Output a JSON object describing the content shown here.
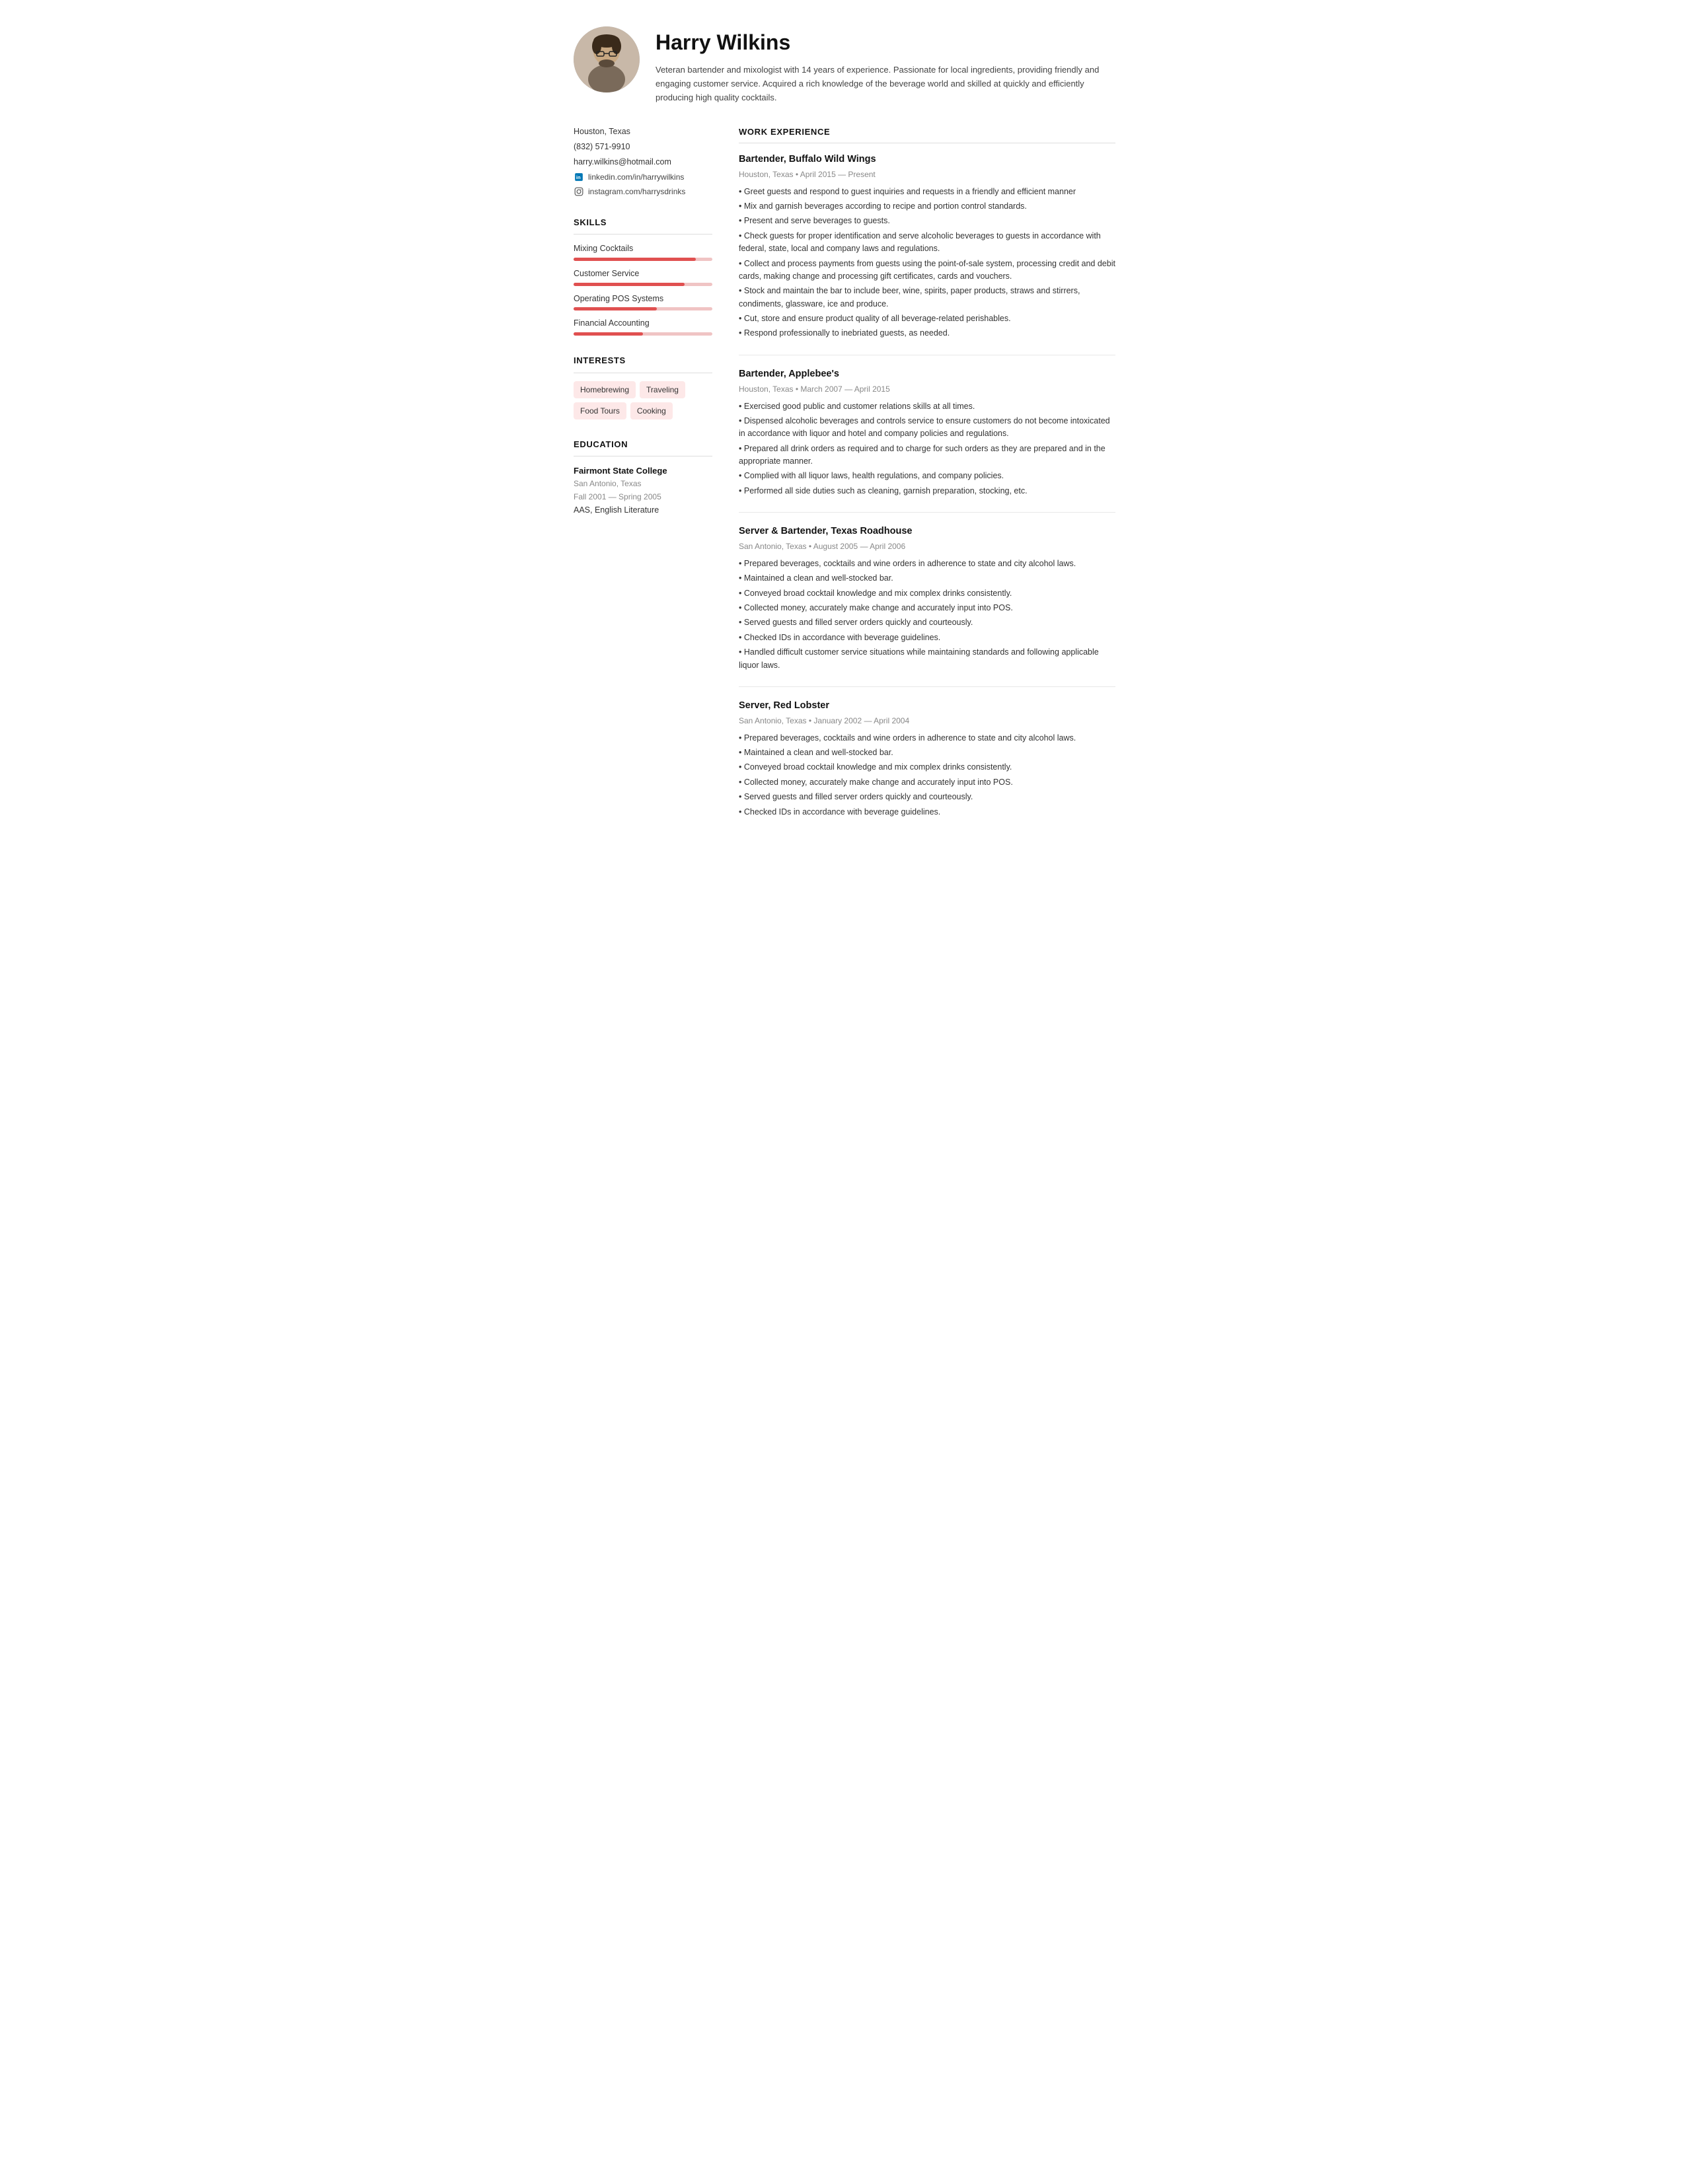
{
  "header": {
    "name": "Harry Wilkins",
    "summary": "Veteran bartender and mixologist with 14 years of experience. Passionate for local ingredients, providing friendly and engaging customer service. Acquired a rich knowledge of the beverage world and skilled at quickly and efficiently producing high quality cocktails.",
    "avatar_alt": "Harry Wilkins photo"
  },
  "sidebar": {
    "contact": {
      "location": "Houston, Texas",
      "phone": "(832) 571-9910",
      "email": "harry.wilkins@hotmail.com",
      "linkedin": "linkedin.com/in/harrywilkins",
      "instagram": "instagram.com/harrysdrinks"
    },
    "skills_title": "SKILLS",
    "skills": [
      {
        "name": "Mixing Cocktails",
        "percent": 88
      },
      {
        "name": "Customer Service",
        "percent": 80
      },
      {
        "name": "Operating POS Systems",
        "percent": 60
      },
      {
        "name": "Financial Accounting",
        "percent": 50
      }
    ],
    "interests_title": "INTERESTS",
    "interests": [
      "Homebrewing",
      "Traveling",
      "Food Tours",
      "Cooking"
    ],
    "education_title": "EDUCATION",
    "education": [
      {
        "school": "Fairmont State College",
        "location": "San Antonio, Texas",
        "dates": "Fall 2001 — Spring 2005",
        "degree": "AAS, English Literature"
      }
    ]
  },
  "main": {
    "work_experience_title": "WORK EXPERIENCE",
    "jobs": [
      {
        "title": "Bartender, Buffalo Wild Wings",
        "meta": "Houston, Texas • April 2015 — Present",
        "bullets": [
          "Greet guests and respond to guest inquiries and requests in a friendly and efficient manner",
          "Mix and garnish beverages according to recipe and portion control standards.",
          "Present and serve beverages to guests.",
          "Check guests for proper identification and serve alcoholic beverages to guests in accordance with federal, state, local and company laws and regulations.",
          "Collect and process payments from guests using the point-of-sale system, processing credit and debit cards, making change and processing gift certificates, cards and vouchers.",
          "Stock and maintain the bar to include beer, wine, spirits, paper products, straws and stirrers, condiments, glassware, ice and produce.",
          "Cut, store and ensure product quality of all beverage-related perishables.",
          "Respond professionally to inebriated guests, as needed."
        ]
      },
      {
        "title": "Bartender, Applebee's",
        "meta": "Houston, Texas • March 2007 — April 2015",
        "bullets": [
          "Exercised good public and customer relations skills at all times.",
          "Dispensed alcoholic beverages and controls service to ensure customers do not become intoxicated in accordance with liquor and hotel and company policies and regulations.",
          "Prepared all drink orders as required and to charge for such orders as they are prepared and in the appropriate manner.",
          "Complied with all liquor laws, health regulations, and company policies.",
          "Performed all side duties such as cleaning, garnish preparation, stocking, etc."
        ]
      },
      {
        "title": "Server & Bartender, Texas Roadhouse",
        "meta": "San Antonio, Texas • August 2005 — April 2006",
        "bullets": [
          "Prepared beverages, cocktails and wine orders in adherence to state and city alcohol laws.",
          "Maintained a clean and well-stocked bar.",
          "Conveyed broad cocktail knowledge and mix complex drinks consistently.",
          "Collected money, accurately make change and accurately input into POS.",
          "Served guests and filled server orders quickly and courteously.",
          "Checked IDs in accordance with beverage guidelines.",
          "Handled difficult customer service situations while maintaining standards and following applicable liquor laws."
        ]
      },
      {
        "title": "Server, Red Lobster",
        "meta": "San Antonio, Texas • January 2002 — April 2004",
        "bullets": [
          "Prepared beverages, cocktails and wine orders in adherence to state and city alcohol laws.",
          "Maintained a clean and well-stocked bar.",
          "Conveyed broad cocktail knowledge and mix complex drinks consistently.",
          "Collected money, accurately make change and accurately input into POS.",
          "Served guests and filled server orders quickly and courteously.",
          "Checked IDs in accordance with beverage guidelines."
        ]
      }
    ]
  }
}
